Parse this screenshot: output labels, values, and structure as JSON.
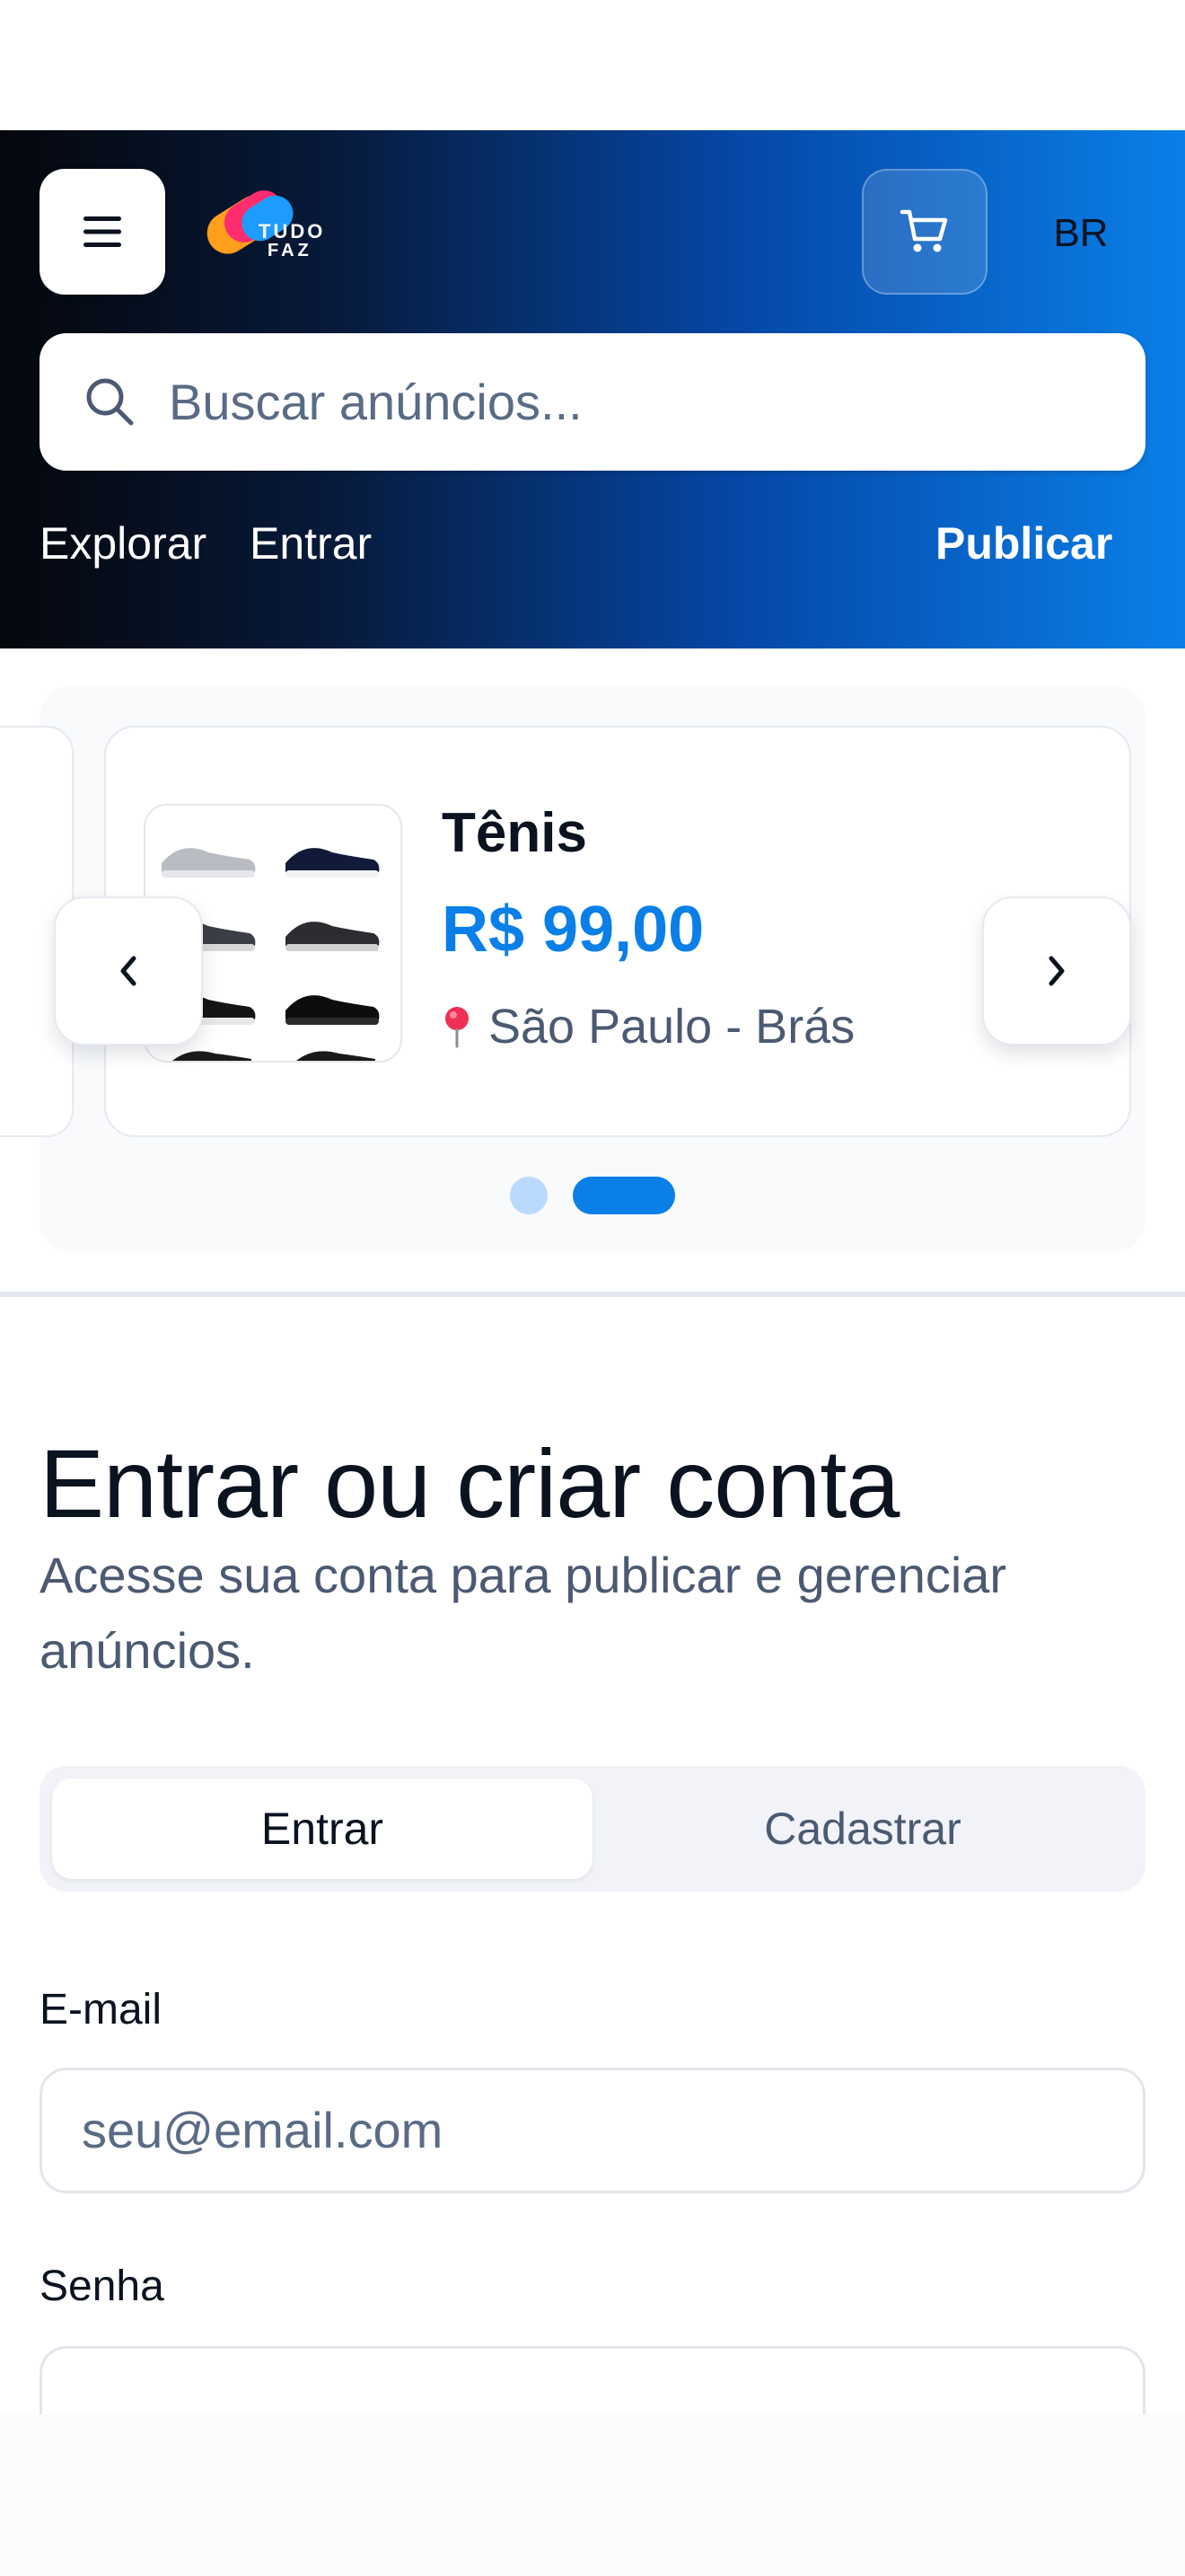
{
  "header": {
    "logo_text_1": "TUDO",
    "logo_text_2": "FAZ",
    "language": "BR",
    "search_placeholder": "Buscar anúncios...",
    "nav": {
      "explore": "Explorar",
      "login": "Entrar",
      "publish": "Publicar"
    }
  },
  "carousel": {
    "items": [
      {
        "title": "Tênis",
        "price": "R$ 99,00",
        "location": "São Paulo - Brás"
      }
    ],
    "active_dot": 2,
    "dot_count": 2
  },
  "auth": {
    "title": "Entrar ou criar conta",
    "subtitle": "Acesse sua conta para publicar e gerenciar anúncios.",
    "tabs": [
      "Entrar",
      "Cadastrar"
    ],
    "active_tab": "Entrar",
    "email_label": "E-mail",
    "email_placeholder": "seu@email.com",
    "password_label": "Senha",
    "password_placeholder": "••••••••"
  },
  "colors": {
    "accent": "#0a7fe8",
    "header_dark": "#05070c",
    "text_muted": "#4b5a72"
  },
  "icons": [
    "menu-icon",
    "cart-icon",
    "search-icon",
    "chevron-left-icon",
    "chevron-right-icon",
    "location-pin-icon"
  ]
}
